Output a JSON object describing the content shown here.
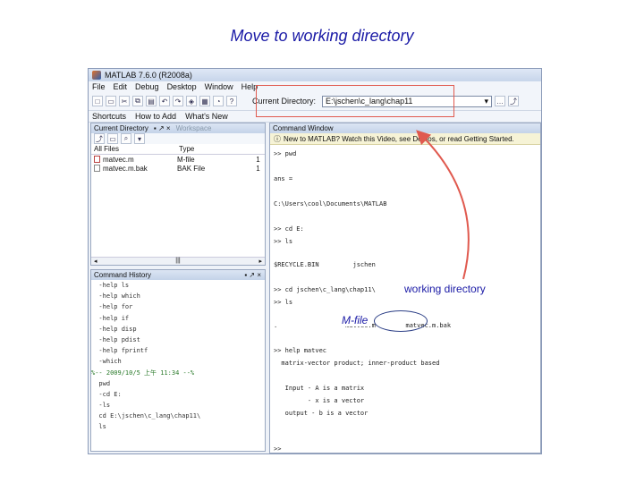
{
  "slide": {
    "title": "Move to working directory",
    "annotation_working_dir": "working directory",
    "annotation_mfile": "M-file",
    "accent_red": "#e05a4f",
    "accent_blue": "#1a1aa6"
  },
  "window": {
    "title": "MATLAB 7.6.0 (R2008a)"
  },
  "menu": [
    "File",
    "Edit",
    "Debug",
    "Desktop",
    "Window",
    "Help"
  ],
  "toolbar": {
    "current_dir_label": "Current Directory:",
    "current_dir_value": "E:\\jschen\\c_lang\\chap11"
  },
  "shortcuts": [
    "Shortcuts",
    "How to Add",
    "What's New"
  ],
  "current_dir_panel": {
    "tab_active": "Current Directory",
    "tab_inactive": "Workspace",
    "col_name": "All Files",
    "col_type": "Type",
    "files": [
      {
        "name": "matvec.m",
        "type": "M-file",
        "size": "1"
      },
      {
        "name": "matvec.m.bak",
        "type": "BAK File",
        "size": "1"
      }
    ]
  },
  "history_panel": {
    "title": "Command History",
    "lines": [
      "  -help ls",
      "  -help which",
      "  -help for",
      "  -help if",
      "  -help disp",
      "  -help pdist",
      "  -help fprintf",
      "  -which",
      "%-- 2009/10/5 上午 11:34 --%",
      "  pwd",
      "  -cd E:",
      "  -ls",
      "  cd E:\\jschen\\c_lang\\chap11\\",
      "  ls"
    ]
  },
  "command_window": {
    "title": "Command Window",
    "info_text": "New to MATLAB? Watch this Video, see Demos, or read Getting Started.",
    "lines": [
      ">> pwd",
      "",
      "ans =",
      "",
      "C:\\Users\\cool\\Documents\\MATLAB",
      "",
      ">> cd E:",
      ">> ls",
      "",
      "$RECYCLE.BIN         jschen",
      "",
      ">> cd jschen\\c_lang\\chap11\\",
      ">> ls",
      "",
      ".                  matvec.m        matvec.m.bak",
      "",
      ">> help matvec",
      "  matrix-vector product; inner-product based",
      "",
      "   Input - A is a matrix",
      "         - x is a vector",
      "   output - b is a vector",
      "",
      "",
      ">>"
    ]
  }
}
